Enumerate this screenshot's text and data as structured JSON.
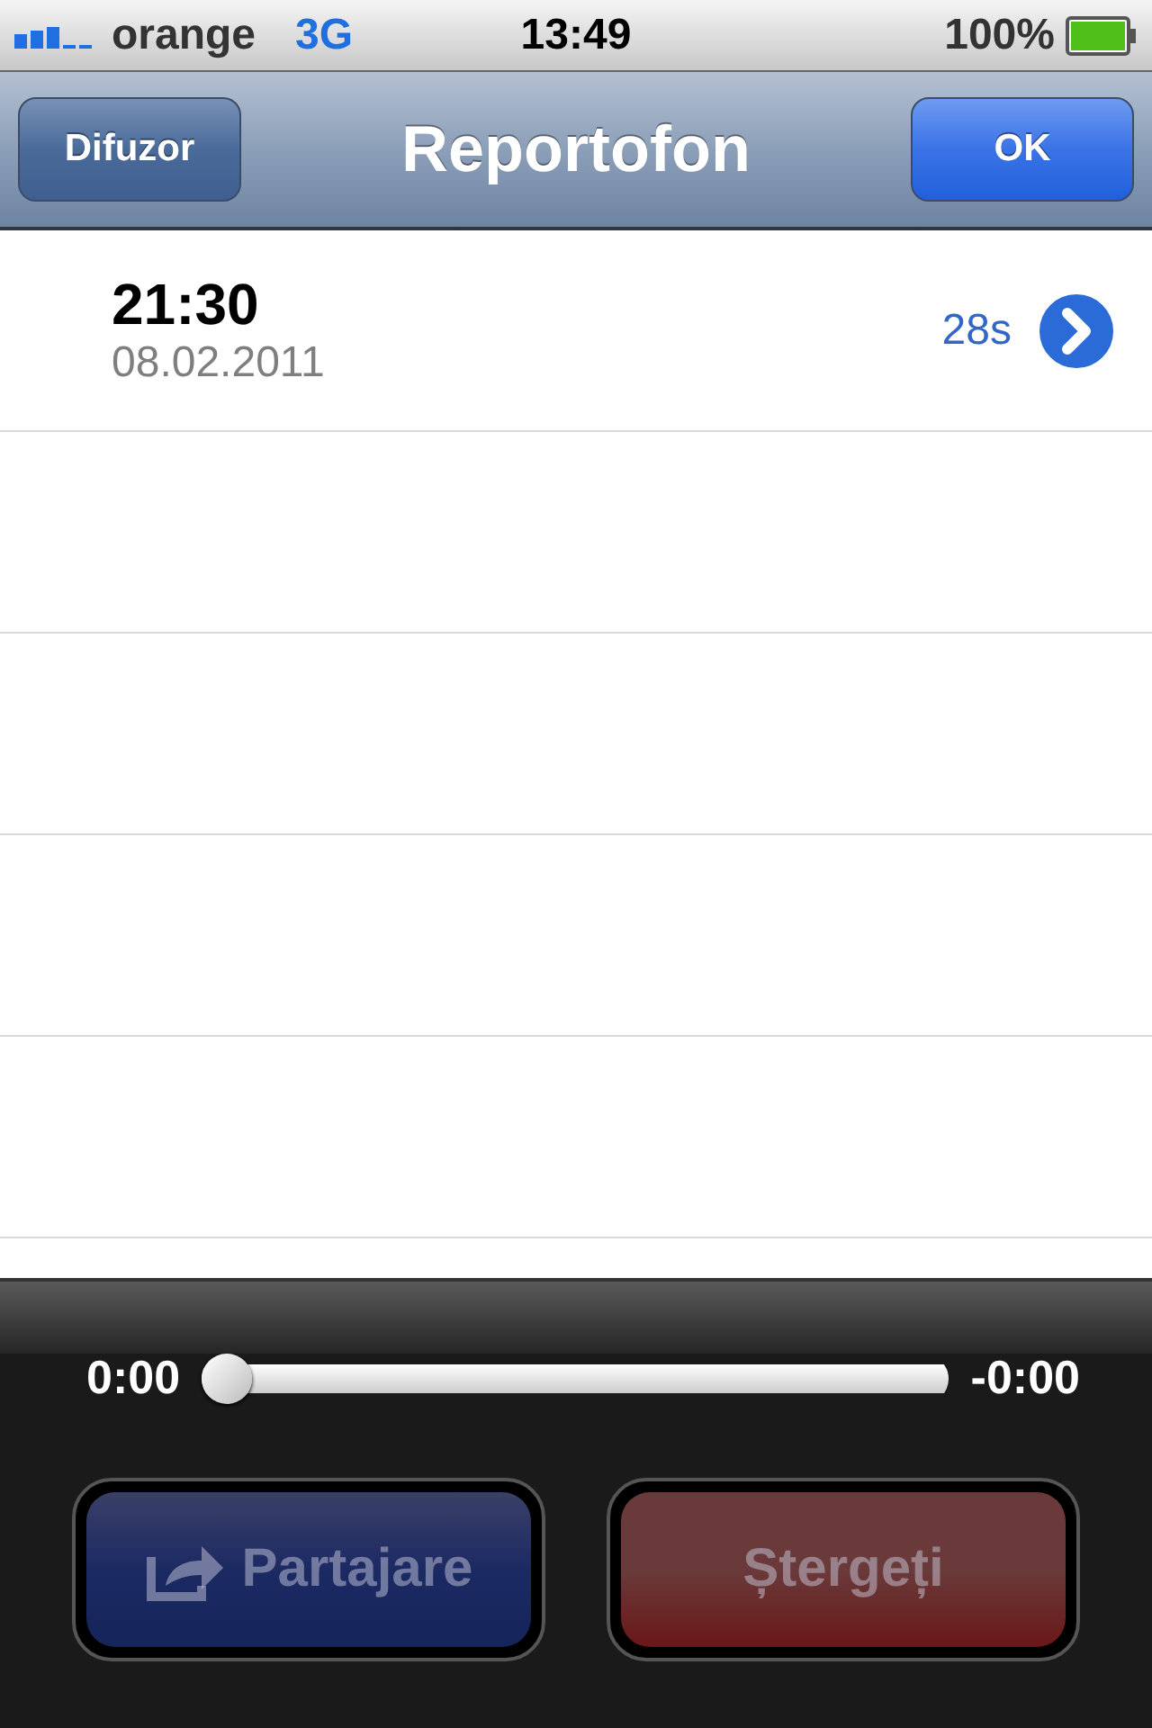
{
  "status_bar": {
    "carrier": "orange",
    "network": "3G",
    "time": "13:49",
    "battery": "100%"
  },
  "nav_bar": {
    "left_button": "Difuzor",
    "title": "Reportofon",
    "right_button": "OK"
  },
  "recordings": [
    {
      "time": "21:30",
      "date": "08.02.2011",
      "duration": "28s"
    }
  ],
  "player": {
    "elapsed": "0:00",
    "remaining": "-0:00",
    "level": 0
  },
  "buttons": [
    {
      "label": "Partajare",
      "kind": "share",
      "disabled": true
    },
    {
      "label": "Ștergeți",
      "kind": "delete",
      "disabled": true
    }
  ]
}
